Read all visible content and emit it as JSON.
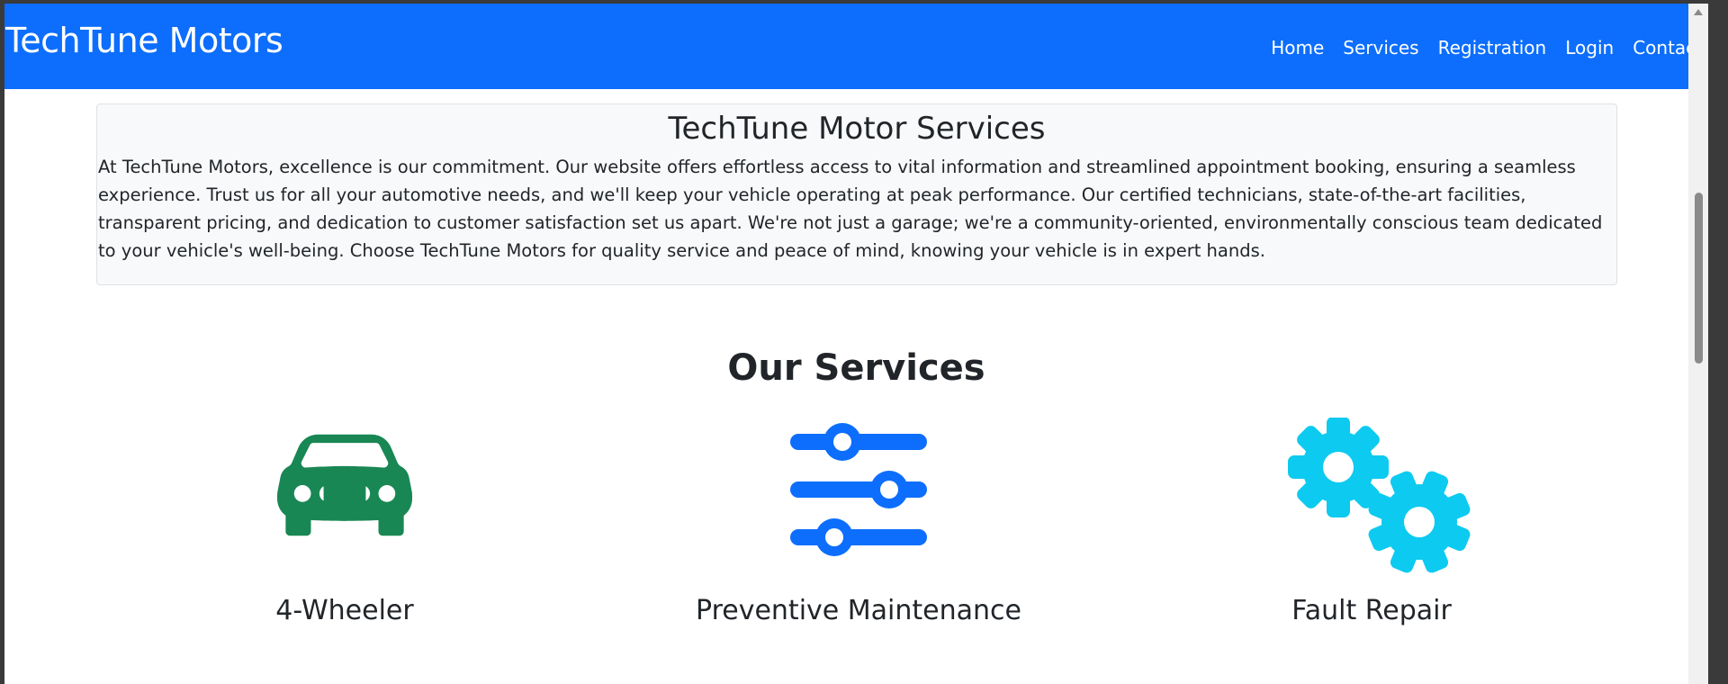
{
  "navbar": {
    "brand": "TechTune Motors",
    "links": [
      "Home",
      "Services",
      "Registration",
      "Login",
      "Contact"
    ],
    "bg_color": "#0d6efd"
  },
  "intro": {
    "title": "TechTune Motor Services",
    "body": "At TechTune Motors, excellence is our commitment. Our website offers effortless access to vital information and streamlined appointment booking, ensuring a seamless experience. Trust us for all your automotive needs, and we'll keep your vehicle operating at peak performance. Our certified technicians, state-of-the-art facilities, transparent pricing, and dedication to customer satisfaction set us apart. We're not just a garage; we're a community-oriented, environmentally conscious team dedicated to your vehicle's well-being. Choose TechTune Motors for quality service and peace of mind, knowing your vehicle is in expert hands."
  },
  "services": {
    "title": "Our Services",
    "items": [
      {
        "label": "4-Wheeler",
        "icon": "car-icon",
        "color": "#198754"
      },
      {
        "label": "Preventive Maintenance",
        "icon": "sliders-icon",
        "color": "#0d6efd"
      },
      {
        "label": "Fault Repair",
        "icon": "gears-icon",
        "color": "#0dcaf0"
      }
    ]
  }
}
